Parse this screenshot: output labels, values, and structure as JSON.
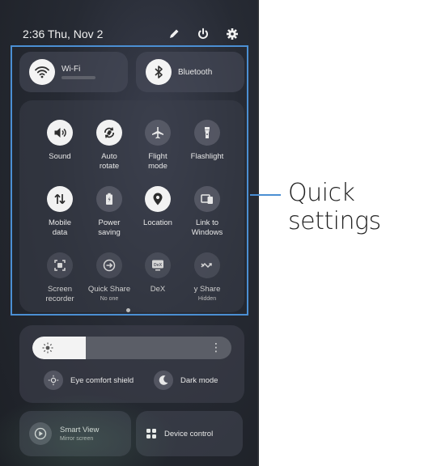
{
  "status_bar": {
    "time_date": "2:36 Thu, Nov 2",
    "icons": [
      "edit-icon",
      "power-icon",
      "gear-icon"
    ]
  },
  "top_tiles": {
    "wifi": {
      "label": "Wi-Fi",
      "icon": "wifi-icon"
    },
    "bluetooth": {
      "label": "Bluetooth",
      "icon": "bluetooth-icon"
    }
  },
  "quick_settings": [
    {
      "label": "Sound",
      "icon": "sound-icon",
      "state": "on"
    },
    {
      "label": "Auto\nrotate",
      "icon": "auto-rotate-icon",
      "state": "on"
    },
    {
      "label": "Flight\nmode",
      "icon": "airplane-icon",
      "state": "off"
    },
    {
      "label": "Flashlight",
      "icon": "flashlight-icon",
      "state": "off"
    },
    {
      "label": "Mobile\ndata",
      "icon": "mobile-data-icon",
      "state": "on"
    },
    {
      "label": "Power\nsaving",
      "icon": "battery-icon",
      "state": "off"
    },
    {
      "label": "Location",
      "icon": "location-icon",
      "state": "on"
    },
    {
      "label": "Link to\nWindows",
      "icon": "link-windows-icon",
      "state": "off"
    },
    {
      "label": "Screen\nrecorder",
      "icon": "screen-recorder-icon",
      "state": "dim"
    },
    {
      "label": "Quick Share",
      "sub": "No one",
      "icon": "quick-share-icon",
      "state": "dim"
    },
    {
      "label": "DeX",
      "icon": "dex-icon",
      "state": "dim"
    },
    {
      "label": "y Share",
      "sub": "Hidden",
      "icon": "music-share-icon",
      "state": "dim"
    }
  ],
  "brightness": {
    "level": 0.27,
    "eye_comfort_label": "Eye comfort shield",
    "dark_mode_label": "Dark mode"
  },
  "bottom_tiles": {
    "smart_view": {
      "title": "Smart View",
      "sub": "Mirror screen"
    },
    "device_control": {
      "title": "Device control"
    }
  },
  "callout": {
    "label": "Quick settings"
  },
  "colors": {
    "accent": "#4b8fd3"
  }
}
